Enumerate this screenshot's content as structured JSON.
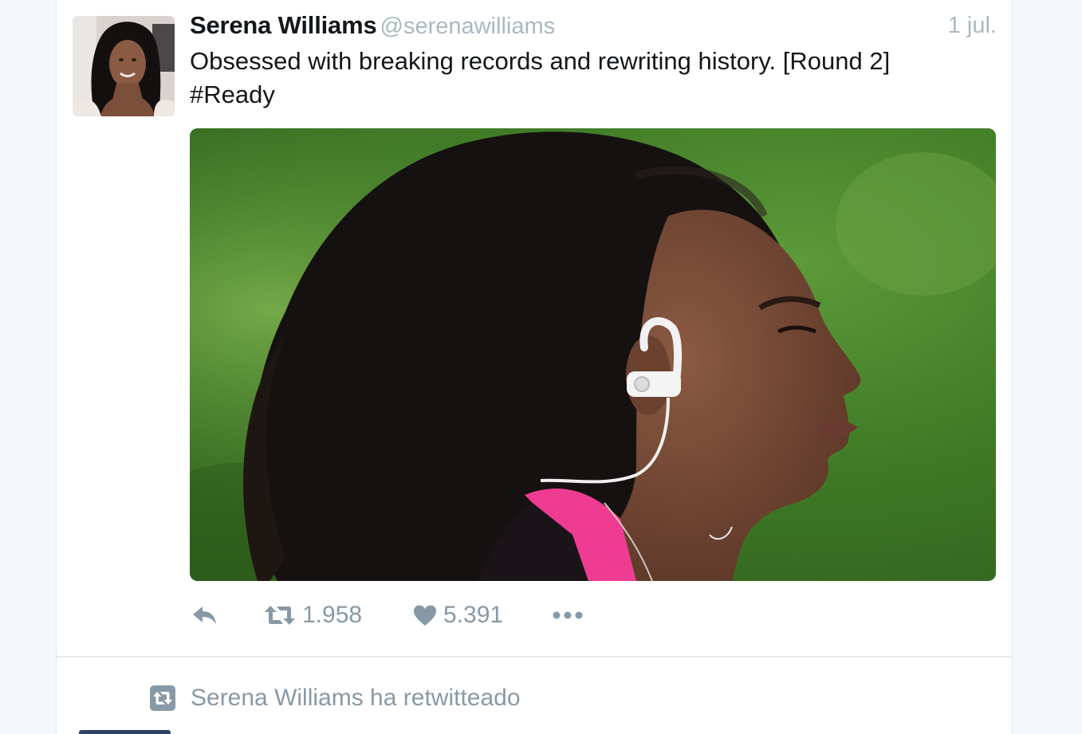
{
  "tweet": {
    "fullname": "Serena Williams",
    "username": "@serenawilliams",
    "time": "1 jul.",
    "text_line1": "Obsessed with breaking records and rewriting history. [Round 2]",
    "text_line2": "#Ready",
    "avatar_icon": "profile-photo",
    "media_icon": "photo",
    "actions": {
      "reply_icon": "reply-icon",
      "retweet_icon": "retweet-icon",
      "retweet_count": "1.958",
      "like_icon": "heart-icon",
      "like_count": "5.391",
      "more_icon": "more-dots-icon"
    }
  },
  "retweet_context": {
    "icon": "retweet-square-icon",
    "text": "Serena Williams ha retwitteado"
  },
  "colors": {
    "background": "#f5f8fa",
    "text_primary": "#14171a",
    "text_muted": "#8899a6",
    "text_light": "#aab8c2",
    "border": "#e1e8ed"
  }
}
